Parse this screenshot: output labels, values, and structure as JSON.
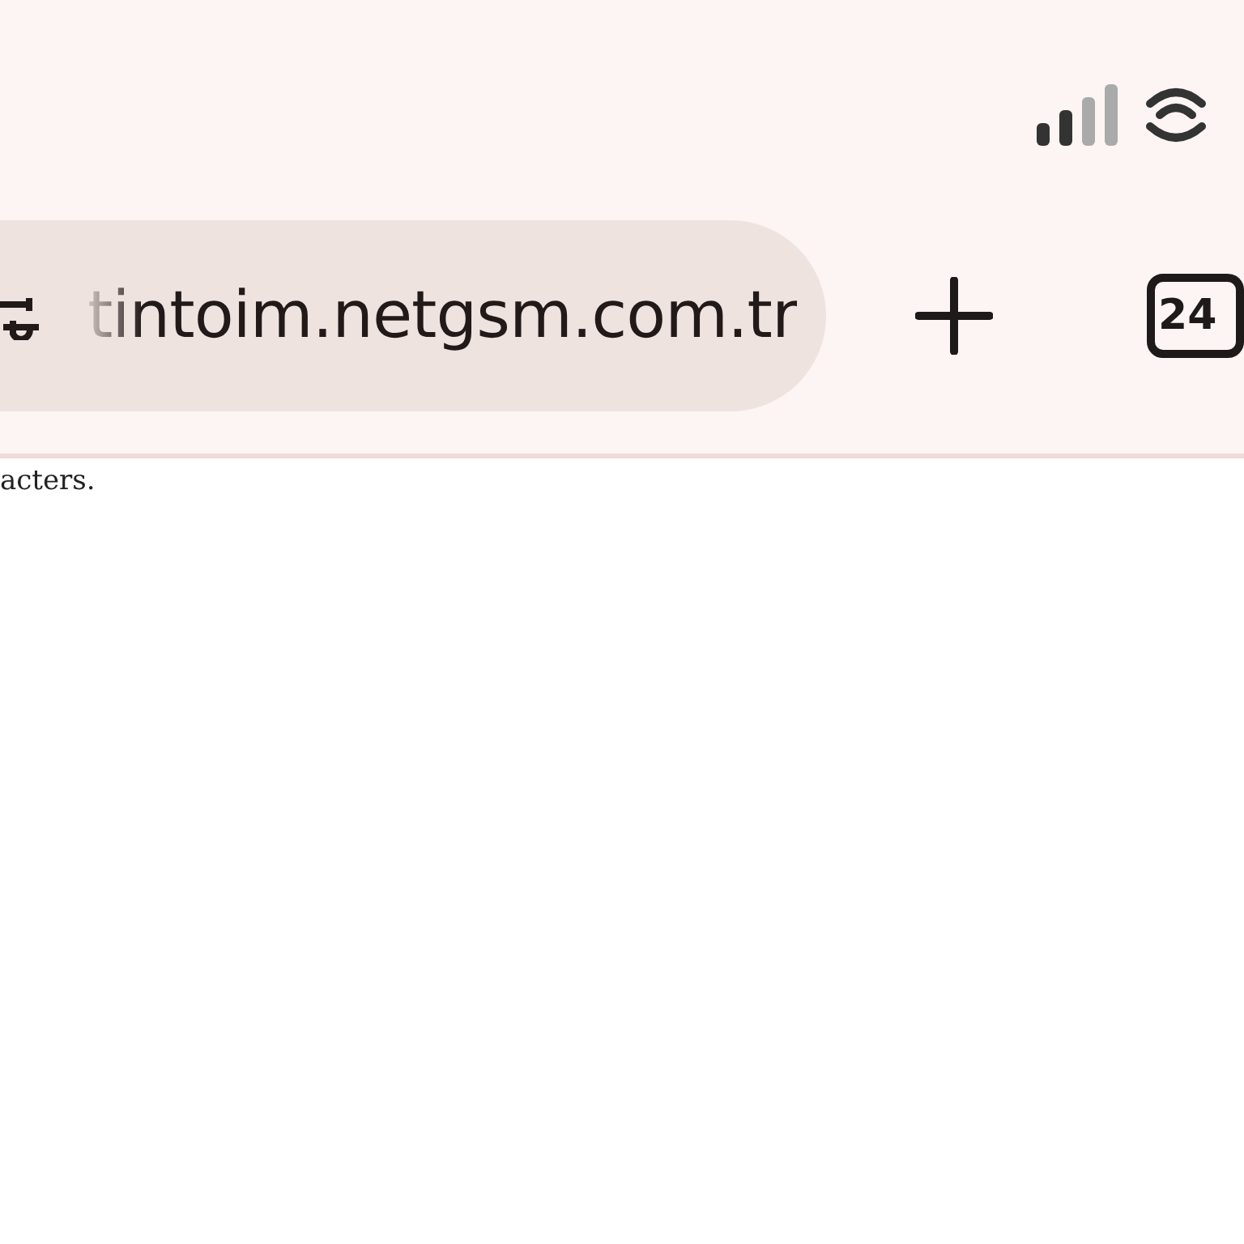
{
  "url_bar": {
    "url": "tintoim.netgsm.com.tr"
  },
  "tab_count": "24",
  "page": {
    "text": "acters."
  }
}
